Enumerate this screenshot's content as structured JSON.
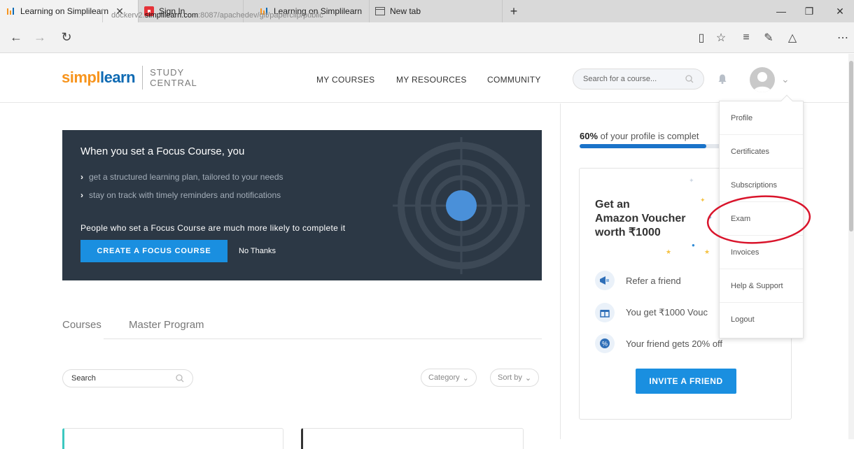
{
  "browser": {
    "tabs": [
      {
        "label": "Learning on Simplilearn",
        "icon": "simplilearn-favicon"
      },
      {
        "label": "Sign In",
        "icon": "signin-favicon"
      },
      {
        "label": "Learning on Simplilearn",
        "icon": "simplilearn-favicon"
      },
      {
        "label": "New tab",
        "icon": "newtab-icon"
      }
    ],
    "url_prefix": "dockerv2.",
    "url_domain": "simplilearn.com",
    "url_suffix": ":8087/apachedev/git/paperclip/public"
  },
  "header": {
    "logo_part1": "simpl",
    "logo_part2": "learn",
    "logo_sub1": "STUDY",
    "logo_sub2": "CENTRAL",
    "nav": [
      "MY COURSES",
      "MY RESOURCES",
      "COMMUNITY"
    ],
    "search_placeholder": "Search for a course..."
  },
  "banner": {
    "title": "When you set a Focus Course, you",
    "points": [
      "get a structured learning plan, tailored to your needs",
      "stay on track with timely reminders and notifications"
    ],
    "note": "People who set a Focus Course are much more likely to complete it",
    "cta": "CREATE A FOCUS COURSE",
    "dismiss": "No Thanks"
  },
  "courses": {
    "tabs": [
      "Courses",
      "Master Program"
    ],
    "search_placeholder": "Search",
    "category": "Category",
    "sort": "Sort by"
  },
  "profile": {
    "percent_label": "60%",
    "text": " of your profile is complet",
    "progress": 0.84
  },
  "referral": {
    "head1": "Get an",
    "head2": "Amazon Voucher",
    "head3": "worth ₹1000",
    "rows": [
      "Refer a friend",
      "You get ₹1000 Vouc",
      "Your friend gets 20% off"
    ],
    "cta": "INVITE A FRIEND"
  },
  "dropdown": {
    "items": [
      "Profile",
      "Certificates",
      "Subscriptions",
      "Exam",
      "Invoices",
      "Help & Support",
      "Logout"
    ]
  },
  "colors": {
    "accent": "#1a8fe0",
    "banner_bg": "#2c3845",
    "highlight": "#d9142b",
    "logo_orange": "#f7941d",
    "logo_blue": "#0e6ab3"
  }
}
